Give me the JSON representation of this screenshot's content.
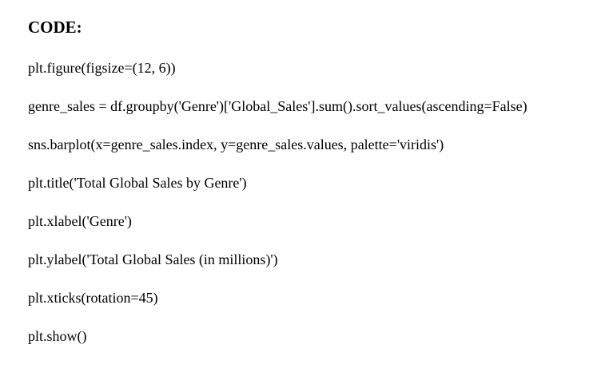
{
  "document": {
    "heading": "CODE:",
    "lines": [
      "plt.figure(figsize=(12, 6))",
      "genre_sales = df.groupby('Genre')['Global_Sales'].sum().sort_values(ascending=False)",
      "sns.barplot(x=genre_sales.index, y=genre_sales.values, palette='viridis')",
      "plt.title('Total Global Sales by Genre')",
      "plt.xlabel('Genre')",
      "plt.ylabel('Total Global Sales (in millions)')",
      "plt.xticks(rotation=45)",
      "plt.show()"
    ]
  }
}
